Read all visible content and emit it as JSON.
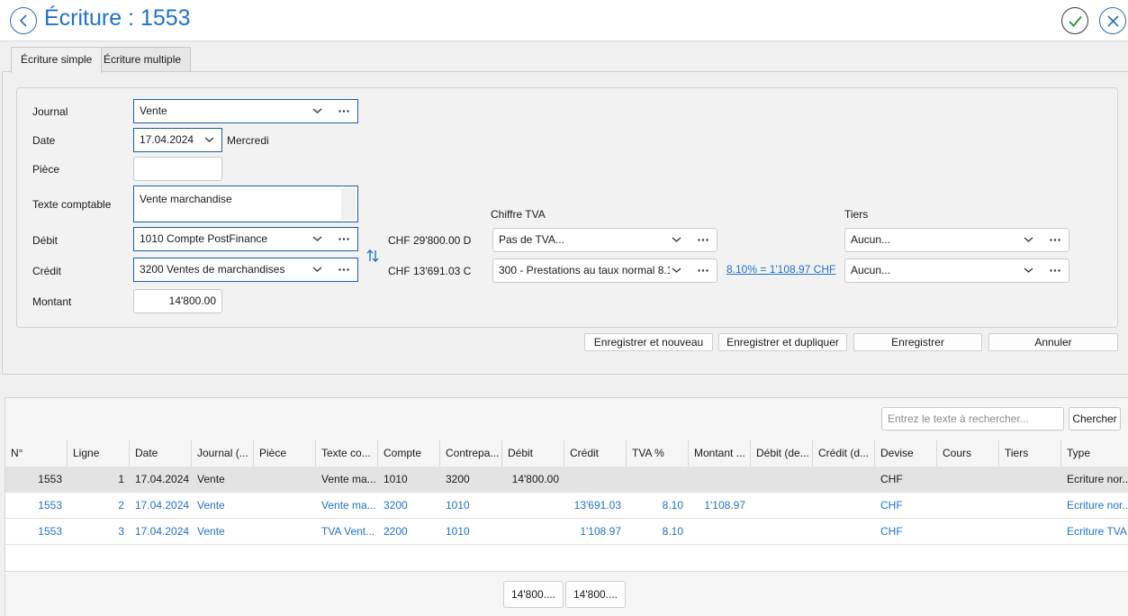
{
  "window": {
    "title": "Écriture : 1553"
  },
  "tabs": [
    {
      "label": "Écriture simple",
      "active": true
    },
    {
      "label": "Écriture multiple",
      "active": false
    }
  ],
  "form": {
    "journal_label": "Journal",
    "journal_value": "Vente",
    "date_label": "Date",
    "date_value": "17.04.2024",
    "date_weekday": "Mercredi",
    "piece_label": "Pièce",
    "piece_value": "",
    "texte_label": "Texte comptable",
    "texte_value": "Vente marchandise",
    "debit_label": "Débit",
    "debit_value": "1010 Compte PostFinance",
    "debit_balance": "CHF 29'800.00 D",
    "credit_label": "Crédit",
    "credit_value": "3200 Ventes de marchandises",
    "credit_balance": "CHF 13'691.03 C",
    "montant_label": "Montant",
    "montant_value": "14'800.00",
    "tva_label": "Chiffre TVA",
    "tva_debit_value": "Pas de TVA...",
    "tva_credit_value": "300 - Prestations au taux normal 8.1...",
    "tva_link": "8.10% = 1'108.97 CHF",
    "tiers_label": "Tiers",
    "tiers_debit_value": "Aucun...",
    "tiers_credit_value": "Aucun..."
  },
  "actions": {
    "save_new": "Enregistrer et nouveau",
    "save_duplicate": "Enregistrer et dupliquer",
    "save": "Enregistrer",
    "cancel": "Annuler"
  },
  "search": {
    "placeholder": "Entrez le texte à rechercher...",
    "button": "Chercher"
  },
  "table": {
    "columns": [
      "N°",
      "Ligne",
      "Date",
      "Journal (...",
      "Pièce",
      "Texte co...",
      "Compte",
      "Contrepa...",
      "Débit",
      "Crédit",
      "TVA %",
      "Montant ...",
      "Débit (de...",
      "Crédit (d...",
      "Devise",
      "Cours",
      "Tiers",
      "Type"
    ],
    "rows": [
      [
        "1553",
        "1",
        "17.04.2024",
        "Vente",
        "",
        "Vente ma...",
        "1010",
        "3200",
        "14'800.00",
        "",
        "",
        "",
        "",
        "",
        "CHF",
        "",
        "",
        "Ecriture nor..."
      ],
      [
        "1553",
        "2",
        "17.04.2024",
        "Vente",
        "",
        "Vente ma...",
        "3200",
        "1010",
        "",
        "13'691.03",
        "8.10",
        "1'108.97",
        "",
        "",
        "CHF",
        "",
        "",
        "Ecriture nor..."
      ],
      [
        "1553",
        "3",
        "17.04.2024",
        "Vente",
        "",
        "TVA Vent...",
        "2200",
        "1010",
        "",
        "1'108.97",
        "8.10",
        "",
        "",
        "",
        "CHF",
        "",
        "",
        "Ecriture TVA"
      ]
    ],
    "totals": [
      "14'800....",
      "14'800...."
    ]
  },
  "colors": {
    "accent": "#1f73c7",
    "selected_row": "#e3e3e3"
  }
}
